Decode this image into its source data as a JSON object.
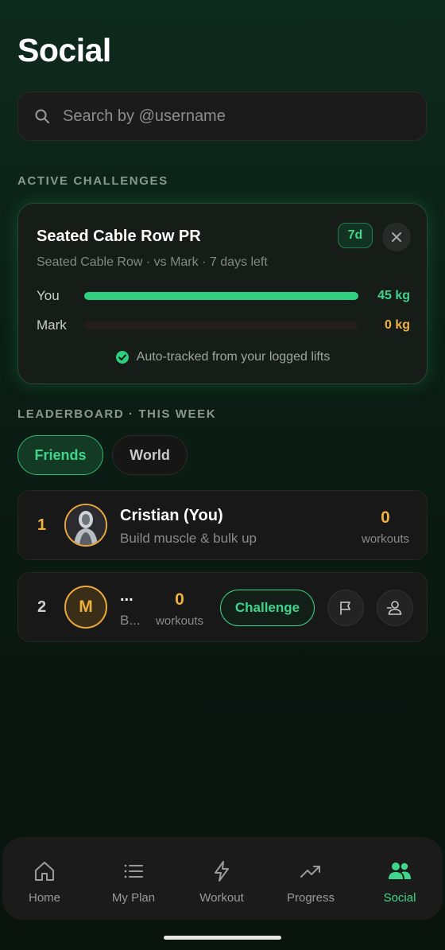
{
  "page": {
    "title": "Social"
  },
  "search": {
    "placeholder": "Search by @username"
  },
  "challenges": {
    "section_label": "ACTIVE CHALLENGES",
    "card": {
      "title": "Seated Cable Row PR",
      "days_badge": "7d",
      "subtitle": "Seated Cable Row · vs Mark · 7 days left",
      "rows": [
        {
          "name": "You",
          "value": "45 kg",
          "progress": 1.0,
          "color": "#3fd58a"
        },
        {
          "name": "Mark",
          "value": "0 kg",
          "progress": 0.0,
          "color": "#f0b041"
        }
      ],
      "auto_tracked": "Auto-tracked from your logged lifts"
    }
  },
  "leaderboard": {
    "section_label": "LEADERBOARD · THIS WEEK",
    "tabs": [
      {
        "label": "Friends",
        "active": true
      },
      {
        "label": "World",
        "active": false
      }
    ],
    "entries": [
      {
        "rank": "1",
        "name": "Cristian (You)",
        "subtitle": "Build muscle & bulk up",
        "count": "0",
        "unit": "workouts",
        "rank_color": "#f0b041"
      },
      {
        "rank": "2",
        "avatar_letter": "M",
        "name": "...",
        "subtitle": "B...",
        "count": "0",
        "unit": "workouts",
        "challenge_label": "Challenge",
        "rank_color": "#cfcfcf"
      }
    ]
  },
  "nav": {
    "items": [
      {
        "label": "Home",
        "icon": "home-icon"
      },
      {
        "label": "My Plan",
        "icon": "list-icon"
      },
      {
        "label": "Workout",
        "icon": "bolt-icon"
      },
      {
        "label": "Progress",
        "icon": "trending-up-icon"
      },
      {
        "label": "Social",
        "icon": "users-icon",
        "active": true
      }
    ]
  },
  "colors": {
    "accent": "#3fd58a",
    "gold": "#f0b041",
    "background": "#0b1f15"
  }
}
